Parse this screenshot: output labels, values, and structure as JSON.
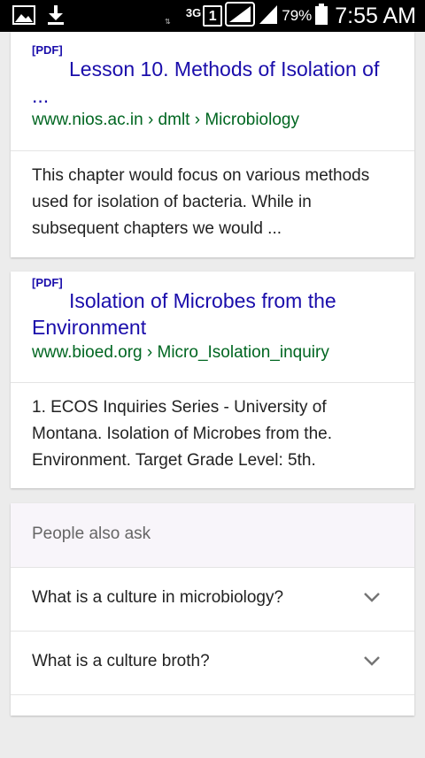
{
  "status_bar": {
    "network_type": "3G",
    "network_arrows": "⇅",
    "sim_slot": "1",
    "battery_percent": "79%",
    "time": "7:55 AM"
  },
  "results": [
    {
      "badge": "[PDF]",
      "title": "Lesson 10. Methods of Isolation of ...",
      "url": "www.nios.ac.in › dmlt › Microbiology",
      "snippet": "This chapter would focus on various methods used for isolation of bacteria. While in subsequent chapters we would ..."
    },
    {
      "badge": "[PDF]",
      "title": "Isolation of Microbes from the Environment",
      "url": "www.bioed.org › Micro_Isolation_inquiry",
      "snippet": "1. ECOS Inquiries Series - University of Montana. Isolation of Microbes from the. Environment. Target Grade Level: 5th."
    }
  ],
  "people_also_ask": {
    "header": "People also ask",
    "questions": [
      "What is a culture in microbiology?",
      "What is a culture broth?"
    ]
  },
  "colors": {
    "link": "#1a0dab",
    "url": "#006621",
    "status_bar": "#000000"
  }
}
